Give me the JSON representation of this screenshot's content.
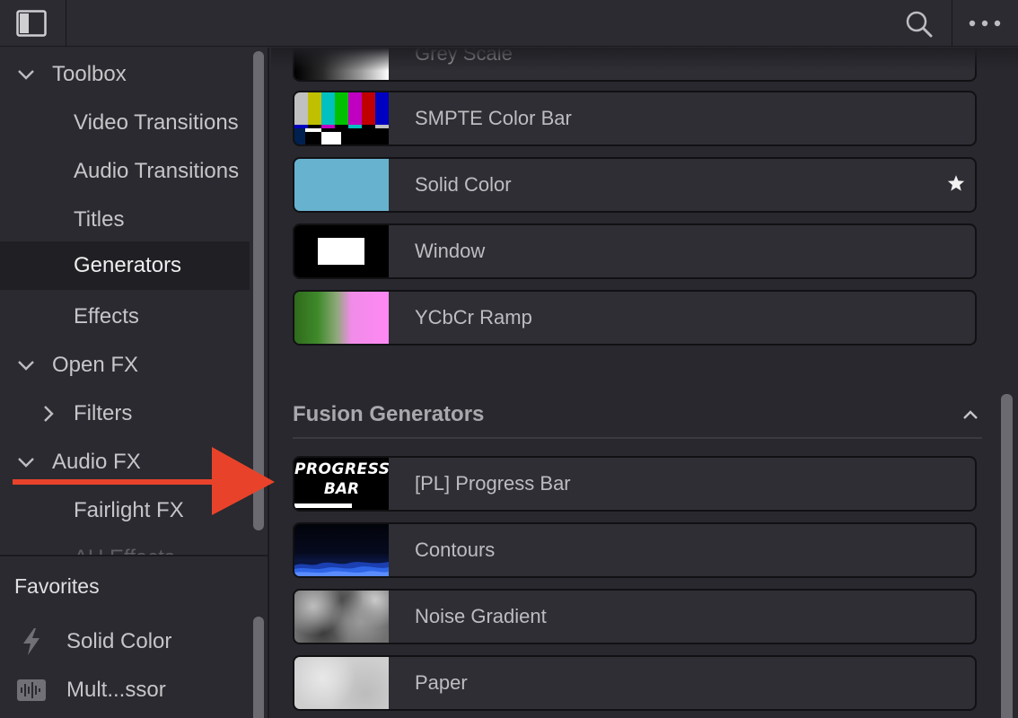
{
  "colors": {
    "accent_arrow": "#e8432a",
    "panel": "#2a2a30",
    "selected": "#1f1f24"
  },
  "topbar": {
    "left_icon": "sidebar-toggle-icon",
    "right_icons": [
      "search-icon",
      "more-options-icon"
    ]
  },
  "sidebar": {
    "tree": [
      {
        "label": "Toolbox",
        "chevron": "chevron-down-icon",
        "level": 0
      },
      {
        "label": "Video Transitions",
        "level": 1
      },
      {
        "label": "Audio Transitions",
        "level": 1
      },
      {
        "label": "Titles",
        "level": 1
      },
      {
        "label": "Generators",
        "level": 1,
        "selected": true
      },
      {
        "label": "Effects",
        "level": 1
      },
      {
        "label": "Open FX",
        "chevron": "chevron-down-icon",
        "level": 0
      },
      {
        "label": "Filters",
        "chevron": "chevron-right-icon",
        "level": 1
      },
      {
        "label": "Audio FX",
        "chevron": "chevron-down-icon",
        "level": 0
      },
      {
        "label": "Fairlight FX",
        "level": 1
      },
      {
        "label": "AU Effects",
        "level": 1,
        "faded": true
      }
    ],
    "favorites": {
      "title": "Favorites",
      "items": [
        {
          "label": "Solid Color",
          "icon": "lightning-bolt-icon"
        },
        {
          "label": "Mult...ssor",
          "icon": "audio-waveform-icon"
        }
      ]
    }
  },
  "generators": {
    "items": [
      {
        "name": "Grey Scale",
        "thumb": "grey-scale"
      },
      {
        "name": "SMPTE Color Bar",
        "thumb": "smpte"
      },
      {
        "name": "Solid Color",
        "thumb": "solid",
        "favorite": true
      },
      {
        "name": "Window",
        "thumb": "window"
      },
      {
        "name": "YCbCr Ramp",
        "thumb": "ycbcr"
      }
    ]
  },
  "fusion": {
    "title": "Fusion Generators",
    "items": [
      {
        "name": "[PL] Progress Bar",
        "thumb": "progress",
        "thumb_text_1": "PROGRESS",
        "thumb_text_2": "BAR"
      },
      {
        "name": "Contours",
        "thumb": "contours"
      },
      {
        "name": "Noise Gradient",
        "thumb": "noise"
      },
      {
        "name": "Paper",
        "thumb": "paper"
      }
    ]
  }
}
